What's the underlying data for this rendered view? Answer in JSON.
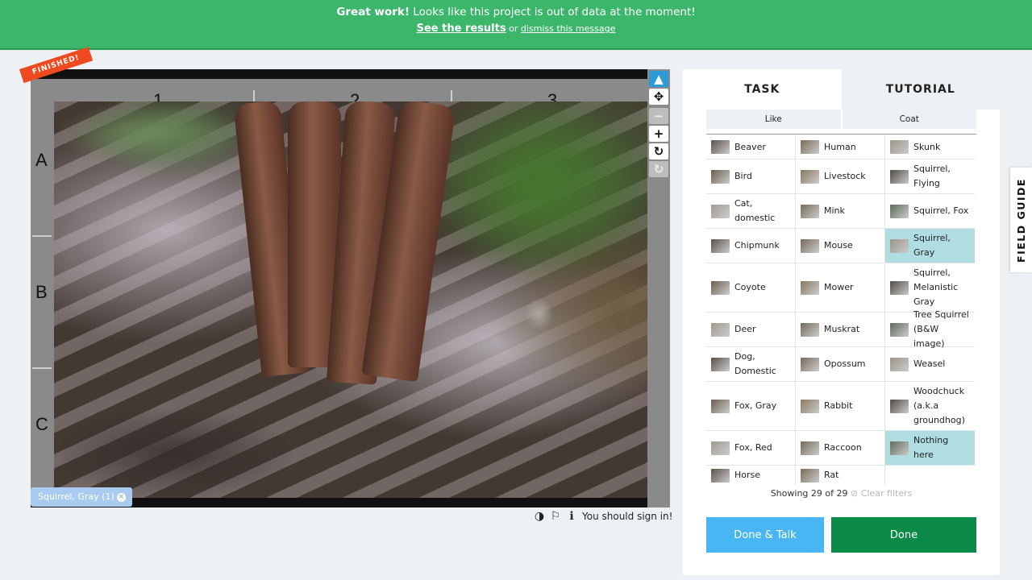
{
  "banner": {
    "headline_bold": "Great work!",
    "headline_rest": " Looks like this project is out of data at the moment!",
    "results_link": "See the results",
    "or_text": " or ",
    "dismiss_link": "dismiss this message",
    "color": "#3cb66b"
  },
  "viewer": {
    "finished_badge": "FINISHED!",
    "columns": [
      "1",
      "2",
      "3"
    ],
    "rows": [
      "A",
      "B",
      "C"
    ],
    "tag_chip": "Squirrel, Gray (1)",
    "tag_close": "×",
    "tools": [
      {
        "name": "pointer-tool",
        "icon": "▲",
        "state": "active"
      },
      {
        "name": "move-tool",
        "icon": "✥",
        "state": "normal"
      },
      {
        "name": "zoom-out-tool",
        "icon": "−",
        "state": "disabled"
      },
      {
        "name": "zoom-in-tool",
        "icon": "+",
        "state": "normal"
      },
      {
        "name": "rotate-tool",
        "icon": "↻",
        "state": "normal"
      },
      {
        "name": "reset-tool",
        "icon": "↻",
        "state": "disabled"
      }
    ],
    "meta_icons": {
      "contrast": "◑",
      "flag": "⚐",
      "info": "ℹ"
    },
    "sign_in_text": "You should sign in!"
  },
  "panel": {
    "tabs": [
      "TASK",
      "TUTORIAL"
    ],
    "filters": [
      "Like",
      "Coat"
    ],
    "species": [
      [
        "Beaver",
        "Human",
        "Skunk"
      ],
      [
        "Bird",
        "Livestock",
        "Squirrel, Flying"
      ],
      [
        "Cat, domestic",
        "Mink",
        "Squirrel, Fox"
      ],
      [
        "Chipmunk",
        "Mouse",
        "Squirrel, Gray"
      ],
      [
        "Coyote",
        "Mower",
        "Squirrel, Melanistic Gray"
      ],
      [
        "Deer",
        "Muskrat",
        "Tree Squirrel (B&W image)"
      ],
      [
        "Dog, Domestic",
        "Opossum",
        "Weasel"
      ],
      [
        "Fox, Gray",
        "Rabbit",
        "Woodchuck (a.k.a groundhog)"
      ],
      [
        "Fox, Red",
        "Raccoon",
        "Nothing here"
      ],
      [
        "Horse",
        "Rat",
        ""
      ]
    ],
    "selected": [
      "Squirrel, Gray",
      "Nothing here"
    ],
    "showing": "Showing 29 of 29",
    "clear_filters": "Clear filters",
    "buttons": {
      "done_talk": "Done & Talk",
      "done": "Done"
    },
    "accent_selected": "#b0dde1",
    "done_color": "#0c8a47",
    "talk_color": "#47b6f2"
  },
  "field_guide": "FIELD GUIDE"
}
